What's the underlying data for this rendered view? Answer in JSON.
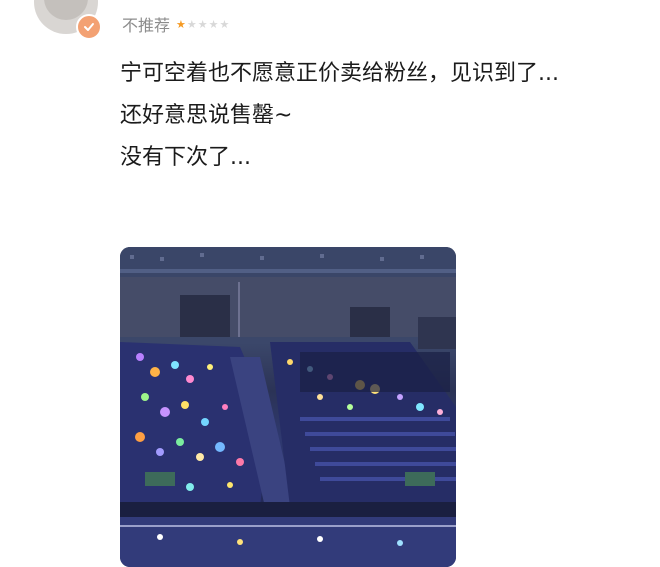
{
  "header": {
    "recommend_label": "不推荐",
    "rating_half_star_color": "#f59a23"
  },
  "review": {
    "lines": [
      "宁可空着也不愿意正价卖给粉丝，见识到了...",
      "还好意思说售罄~",
      "没有下次了..."
    ]
  },
  "photo": {
    "scene": "concert-arena-seats-lightsticks"
  },
  "colors": {
    "verified_badge": "#f3a173",
    "muted_text": "#8c8c8c"
  }
}
